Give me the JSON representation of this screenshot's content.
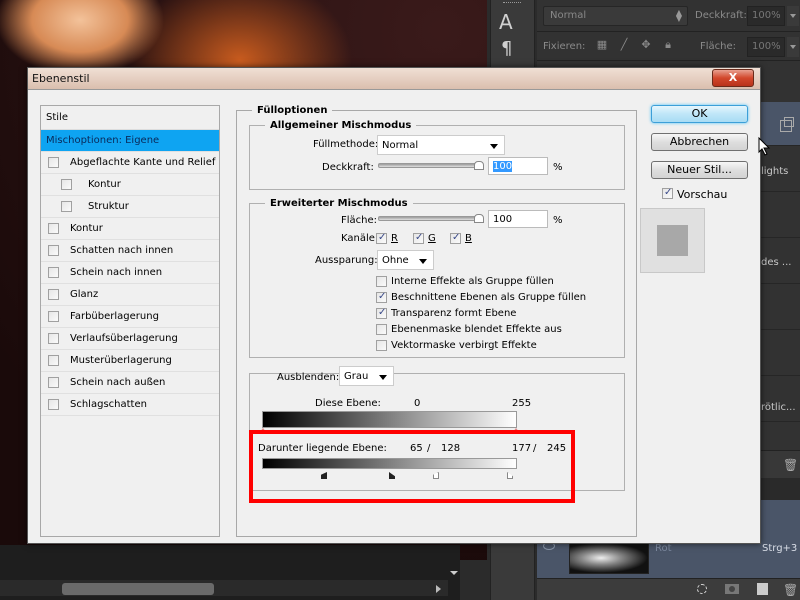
{
  "photoshop": {
    "layers_panel": {
      "blend_mode": "Normal",
      "opacity_label": "Deckkraft:",
      "opacity_value": "100%",
      "lock_label": "Fixieren:",
      "fill_label": "Fläche:",
      "fill_value": "100%",
      "layer_texts": [
        "lights",
        "des ...",
        "rötlic..."
      ],
      "bottom_layer_name": "Rot",
      "bottom_layer_shortcut": "Strg+3"
    },
    "tool_glyphs": {
      "type_tool": "A",
      "paragraph": "¶"
    }
  },
  "dialog": {
    "title": "Ebenenstil",
    "close_label": "X",
    "styles_header": "Stile",
    "styles": [
      {
        "label": "Mischoptionen: Eigene",
        "selected": true,
        "has_checkbox": false,
        "checked": false,
        "sub": false
      },
      {
        "label": "Abgeflachte Kante und Relief",
        "selected": false,
        "has_checkbox": true,
        "checked": false,
        "sub": false
      },
      {
        "label": "Kontur",
        "selected": false,
        "has_checkbox": true,
        "checked": false,
        "sub": true
      },
      {
        "label": "Struktur",
        "selected": false,
        "has_checkbox": true,
        "checked": false,
        "sub": true
      },
      {
        "label": "Kontur",
        "selected": false,
        "has_checkbox": true,
        "checked": false,
        "sub": false
      },
      {
        "label": "Schatten nach innen",
        "selected": false,
        "has_checkbox": true,
        "checked": false,
        "sub": false
      },
      {
        "label": "Schein nach innen",
        "selected": false,
        "has_checkbox": true,
        "checked": false,
        "sub": false
      },
      {
        "label": "Glanz",
        "selected": false,
        "has_checkbox": true,
        "checked": false,
        "sub": false
      },
      {
        "label": "Farbüberlagerung",
        "selected": false,
        "has_checkbox": true,
        "checked": false,
        "sub": false
      },
      {
        "label": "Verlaufsüberlagerung",
        "selected": false,
        "has_checkbox": true,
        "checked": false,
        "sub": false
      },
      {
        "label": "Musterüberlagerung",
        "selected": false,
        "has_checkbox": true,
        "checked": false,
        "sub": false
      },
      {
        "label": "Schein nach außen",
        "selected": false,
        "has_checkbox": true,
        "checked": false,
        "sub": false
      },
      {
        "label": "Schlagschatten",
        "selected": false,
        "has_checkbox": true,
        "checked": false,
        "sub": false
      }
    ],
    "fill_options": {
      "title": "Fülloptionen",
      "general": {
        "title": "Allgemeiner Mischmodus",
        "blend_label": "Füllmethode:",
        "blend_value": "Normal",
        "opacity_label": "Deckkraft:",
        "opacity_value": "100",
        "opacity_percent": 100,
        "unit": "%"
      },
      "advanced": {
        "title": "Erweiterter Mischmodus",
        "fill_label": "Fläche:",
        "fill_value": "100",
        "fill_percent": 100,
        "unit": "%",
        "channels_label": "Kanäle:",
        "channels": [
          {
            "label": "R",
            "checked": true
          },
          {
            "label": "G",
            "checked": true
          },
          {
            "label": "B",
            "checked": true
          }
        ],
        "knockout_label": "Aussparung:",
        "knockout_value": "Ohne",
        "options": [
          {
            "label": "Interne Effekte als Gruppe füllen",
            "checked": false
          },
          {
            "label": "Beschnittene Ebenen als Gruppe füllen",
            "checked": true
          },
          {
            "label": "Transparenz formt Ebene",
            "checked": true
          },
          {
            "label": "Ebenenmaske blendet Effekte aus",
            "checked": false
          },
          {
            "label": "Vektormaske verbirgt Effekte",
            "checked": false
          }
        ]
      },
      "blend_if": {
        "label": "Ausblenden:",
        "value": "Grau",
        "this_layer_label": "Diese Ebene:",
        "this_layer_low": "0",
        "this_layer_high": "255",
        "underlying_label": "Darunter liegende Ebene:",
        "underlying_low_a": "65",
        "underlying_low_b": "128",
        "underlying_high_a": "177",
        "underlying_high_b": "245",
        "separator": "/"
      }
    },
    "buttons": {
      "ok": "OK",
      "cancel": "Abbrechen",
      "new_style": "Neuer Stil...",
      "preview_label": "Vorschau",
      "preview_checked": true
    },
    "highlight_color": "#ff0000",
    "selected_color": "#0ea4f2"
  }
}
